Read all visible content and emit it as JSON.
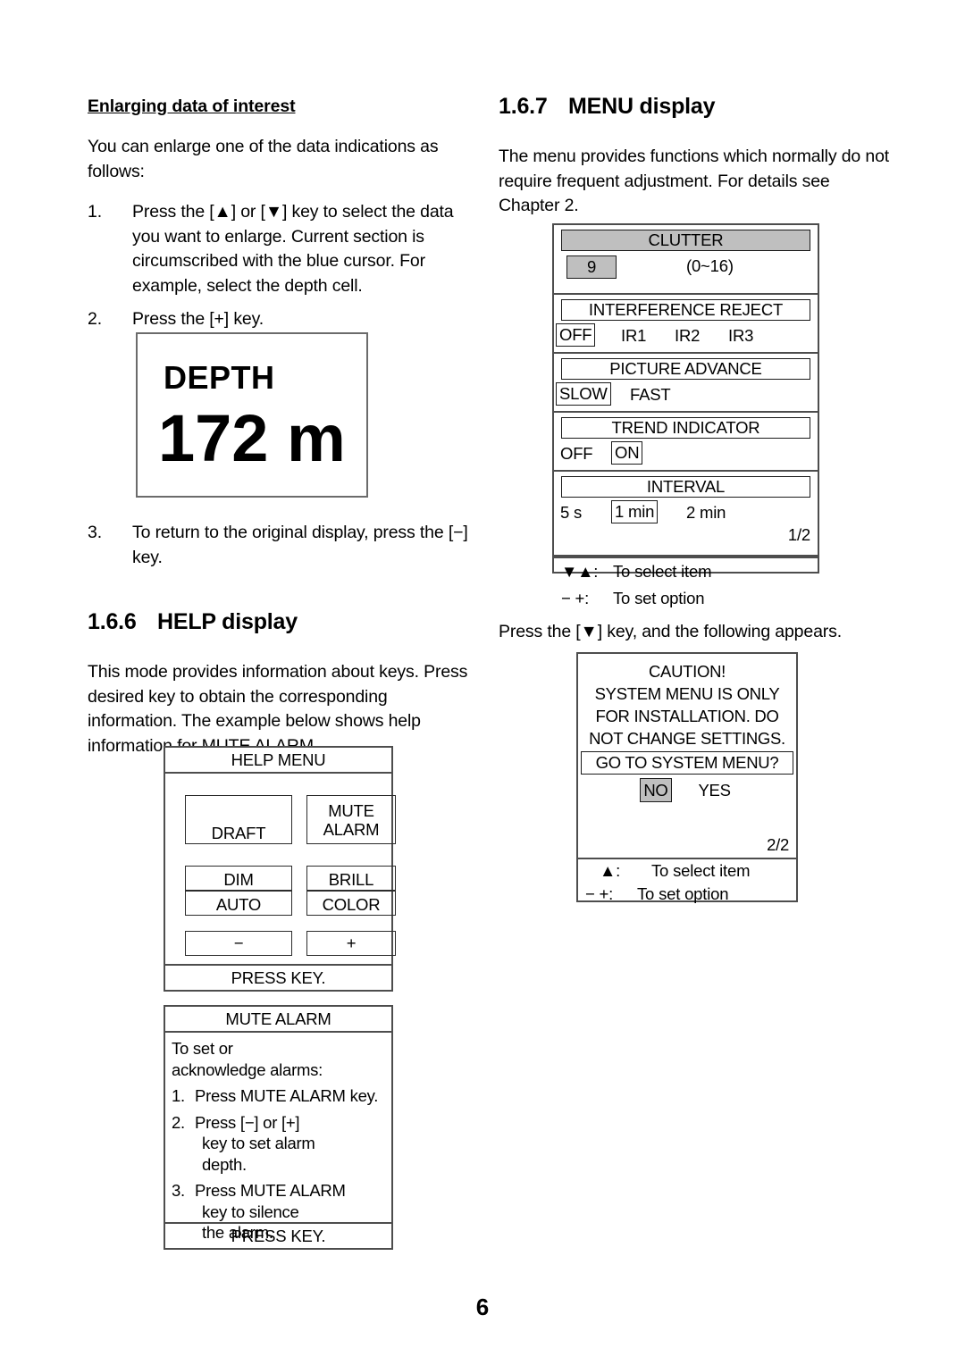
{
  "page_number": "6",
  "left_column": {
    "subsection_heading": "Enlarging data of interest",
    "intro": "You can enlarge one of the data indications as follows:",
    "steps": [
      {
        "marker": "1.",
        "text": "Press the [▲] or [▼] key to select the data you want to enlarge. Current section is circumscribed with the blue cursor. For example, select the depth cell."
      },
      {
        "marker": "2.",
        "text": "Press the [+] key."
      }
    ],
    "step3": {
      "marker": "3.",
      "text": "To return to the original display, press the [−] key."
    },
    "depth_display": {
      "label": "DEPTH",
      "value": "172 m"
    },
    "help_section": {
      "number": "1.6.6",
      "title": "HELP display",
      "body": "This mode provides information about keys. Press desired key to obtain the corresponding information. The example below shows help information for MUTE ALARM."
    },
    "help_menu": {
      "title": "HELP MENU",
      "footer": "PRESS KEY.",
      "buttons": [
        {
          "label": "DRAFT",
          "lines": [
            "DRAFT"
          ]
        },
        {
          "label": "MUTE ALARM",
          "lines": [
            "MUTE",
            "ALARM"
          ]
        },
        {
          "label": "DIM",
          "lines": [
            "DIM"
          ]
        },
        {
          "label": "BRILL",
          "lines": [
            "BRILL"
          ]
        },
        {
          "label": "AUTO",
          "lines": [
            "AUTO"
          ]
        },
        {
          "label": "COLOR",
          "lines": [
            "COLOR"
          ]
        },
        {
          "label": "minus",
          "lines": [
            "−"
          ]
        },
        {
          "label": "plus",
          "lines": [
            "+"
          ]
        }
      ]
    },
    "mute_alarm_help": {
      "title": "MUTE ALARM",
      "footer": "PRESS KEY.",
      "intro_line1": "To set or",
      "intro_line2": "acknowledge alarms:",
      "steps": [
        {
          "marker": "1.",
          "lines": [
            "Press MUTE ALARM key."
          ]
        },
        {
          "marker": "2.",
          "lines": [
            "Press [−] or [+]",
            "key to set alarm",
            "depth."
          ]
        },
        {
          "marker": "3.",
          "lines": [
            "Press MUTE ALARM",
            "key to silence",
            "the alarm."
          ]
        }
      ]
    }
  },
  "right_column": {
    "menu_section": {
      "number": "1.6.7",
      "title": "MENU display",
      "body": "The menu provides functions which normally do not require frequent adjustment. For details see Chapter 2."
    },
    "menu_display": {
      "items": [
        {
          "header": "CLUTTER",
          "header_shaded": true,
          "value": "9",
          "value_filled": true,
          "range": "(0~16)"
        },
        {
          "header": "INTERFERENCE REJECT",
          "header_shaded": false,
          "options": [
            "OFF",
            "IR1",
            "IR2",
            "IR3"
          ],
          "selected": "OFF"
        },
        {
          "header": "PICTURE ADVANCE",
          "header_shaded": false,
          "options": [
            "SLOW",
            "FAST"
          ],
          "selected": "SLOW"
        },
        {
          "header": "TREND INDICATOR",
          "header_shaded": false,
          "options": [
            "OFF",
            "ON"
          ],
          "selected": "ON"
        },
        {
          "header": "INTERVAL",
          "header_shaded": false,
          "options": [
            "5 s",
            "1 min",
            "2 min"
          ],
          "selected": "1 min",
          "page_indicator": "1/2"
        }
      ],
      "legend": [
        {
          "key": "▼▲:",
          "text": "To select item"
        },
        {
          "key": "−  +:",
          "text": "To set option"
        }
      ]
    },
    "press_down_note": "Press the [▼] key, and the following appears.",
    "caution_display": {
      "title": "CAUTION!",
      "lines": [
        "SYSTEM MENU IS ONLY",
        "FOR INSTALLATION. DO",
        "NOT CHANGE SETTINGS."
      ],
      "question": "GO TO SYSTEM MENU?",
      "choices": [
        "NO",
        "YES"
      ],
      "selected": "NO",
      "page_indicator": "2/2",
      "legend": [
        {
          "key": "▲:",
          "text": "To select item"
        },
        {
          "key": "−  +:",
          "text": "To set option"
        }
      ]
    }
  }
}
